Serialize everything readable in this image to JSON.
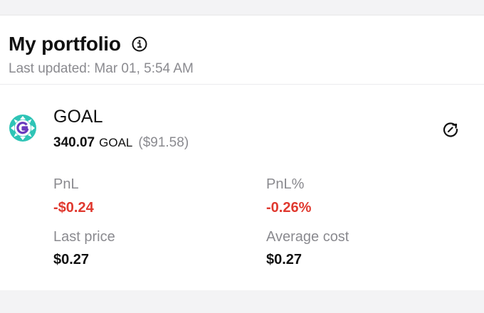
{
  "portfolio": {
    "title": "My portfolio",
    "updated": "Last updated: Mar 01, 5:54 AM"
  },
  "token": {
    "name": "GOAL",
    "amount": "340.07",
    "symbol": "GOAL",
    "usd_value": "($91.58)",
    "logo_icon": "goal-token-logo",
    "logo_colors": [
      "#2ec4b6",
      "#6a3bbd",
      "#ffffff"
    ]
  },
  "metrics": {
    "pnl": {
      "label": "PnL",
      "value": "-$0.24"
    },
    "pnl_percent": {
      "label": "PnL%",
      "value": "-0.26%"
    },
    "last_price": {
      "label": "Last price",
      "value": "$0.27"
    },
    "average_cost": {
      "label": "Average cost",
      "value": "$0.27"
    }
  },
  "colors": {
    "negative": "#e0392f",
    "muted": "#8a8a8f",
    "text": "#111111"
  }
}
